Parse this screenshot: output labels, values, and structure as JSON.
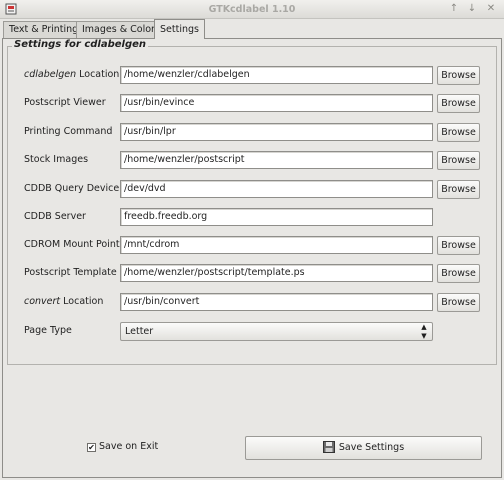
{
  "window": {
    "title": "GTKcdlabel 1.10",
    "minimize_glyph": "↑",
    "maximize_glyph": "↓",
    "close_glyph": "✕"
  },
  "tabs": [
    {
      "label": "Text & Printing",
      "active": false
    },
    {
      "label": "Images & Colors",
      "active": false
    },
    {
      "label": "Settings",
      "active": true
    }
  ],
  "settings": {
    "frame_title": "Settings for cdlabelgen",
    "browse_label": "Browse",
    "rows": [
      {
        "label_em": "cdlabelgen",
        "label": " Location",
        "value": "/home/wenzler/cdlabelgen",
        "browse": true
      },
      {
        "label_em": "",
        "label": "Postscript Viewer",
        "value": "/usr/bin/evince",
        "browse": true
      },
      {
        "label_em": "",
        "label": "Printing Command",
        "value": "/usr/bin/lpr",
        "browse": true
      },
      {
        "label_em": "",
        "label": "Stock Images",
        "value": "/home/wenzler/postscript",
        "browse": true
      },
      {
        "label_em": "",
        "label": "CDDB Query Device",
        "value": "/dev/dvd",
        "browse": true
      },
      {
        "label_em": "",
        "label": "CDDB Server",
        "value": "freedb.freedb.org",
        "browse": false
      },
      {
        "label_em": "",
        "label": "CDROM Mount Point",
        "value": "/mnt/cdrom",
        "browse": true
      },
      {
        "label_em": "",
        "label": "Postscript Template",
        "value": "/home/wenzler/postscript/template.ps",
        "browse": true
      },
      {
        "label_em": "convert",
        "label": " Location",
        "value": "/usr/bin/convert",
        "browse": true
      }
    ],
    "page_type": {
      "label": "Page Type",
      "selected": "Letter"
    }
  },
  "footer": {
    "save_on_exit": {
      "label": "Save on Exit",
      "checked": true,
      "check_glyph": "✔"
    },
    "save_settings_label": "Save Settings"
  },
  "icons": {
    "app": "app-icon",
    "save": "floppy-disk-icon"
  },
  "colors": {
    "window_bg": "#e8e7e4",
    "entry_bg": "#ffffff",
    "title_text": "#a9a8a4"
  }
}
